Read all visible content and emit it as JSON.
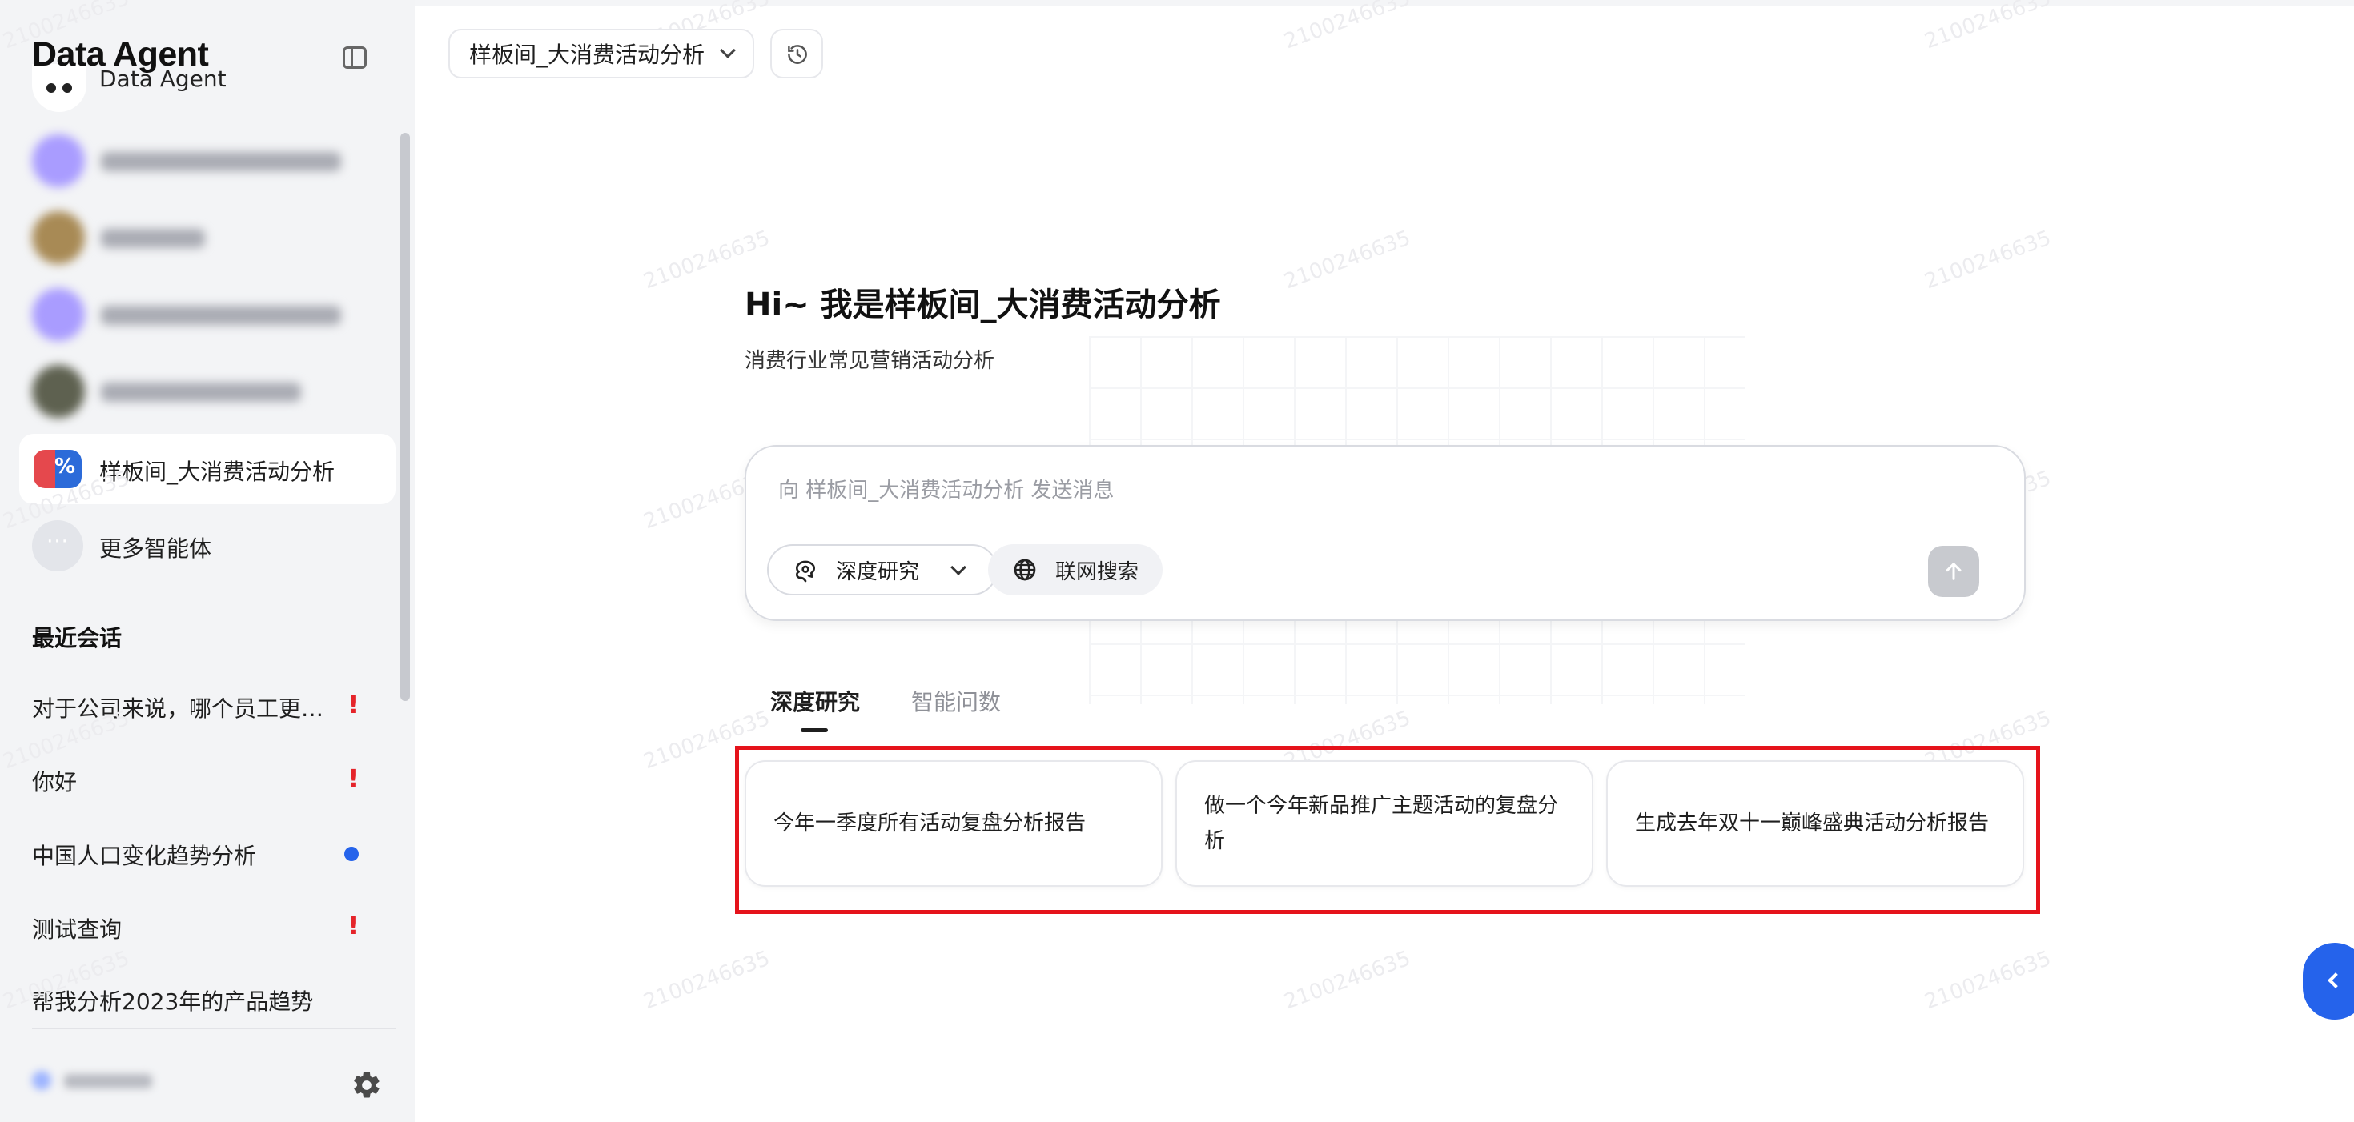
{
  "sidebar": {
    "logo": "Data Agent",
    "agents": [
      {
        "name": "Data Agent"
      },
      {
        "name": "样板间_大消费活动分析"
      },
      {
        "name": "更多智能体"
      }
    ],
    "recent_title": "最近会话",
    "conversations": [
      {
        "title": "对于公司来说，哪个员工更剧…",
        "status": "error"
      },
      {
        "title": "你好",
        "status": "error"
      },
      {
        "title": "中国人口变化趋势分析",
        "status": "running"
      },
      {
        "title": "测试查询",
        "status": "error"
      },
      {
        "title": "帮我分析2023年的产品趋势",
        "status": "none"
      }
    ],
    "alert_mark": "!"
  },
  "header": {
    "agent_selector": "样板间_大消费活动分析"
  },
  "main": {
    "greeting": "Hi~ 我是样板间_大消费活动分析",
    "subtitle": "消费行业常见营销活动分析",
    "input_placeholder": "向 样板间_大消费活动分析 发送消息",
    "deep_research_label": "深度研究",
    "web_search_label": "联网搜索",
    "tabs": [
      {
        "label": "深度研究",
        "active": true
      },
      {
        "label": "智能问数",
        "active": false
      }
    ],
    "suggestions": [
      "今年一季度所有活动复盘分析报告",
      "做一个今年新品推广主题活动的复盘分析",
      "生成去年双十一巅峰盛典活动分析报告"
    ]
  },
  "watermark": "2100246635",
  "colors": {
    "accent": "#2563eb",
    "alert": "#e5242a",
    "highlight": "#e5131b",
    "sidebar_bg": "#f3f4f6"
  }
}
